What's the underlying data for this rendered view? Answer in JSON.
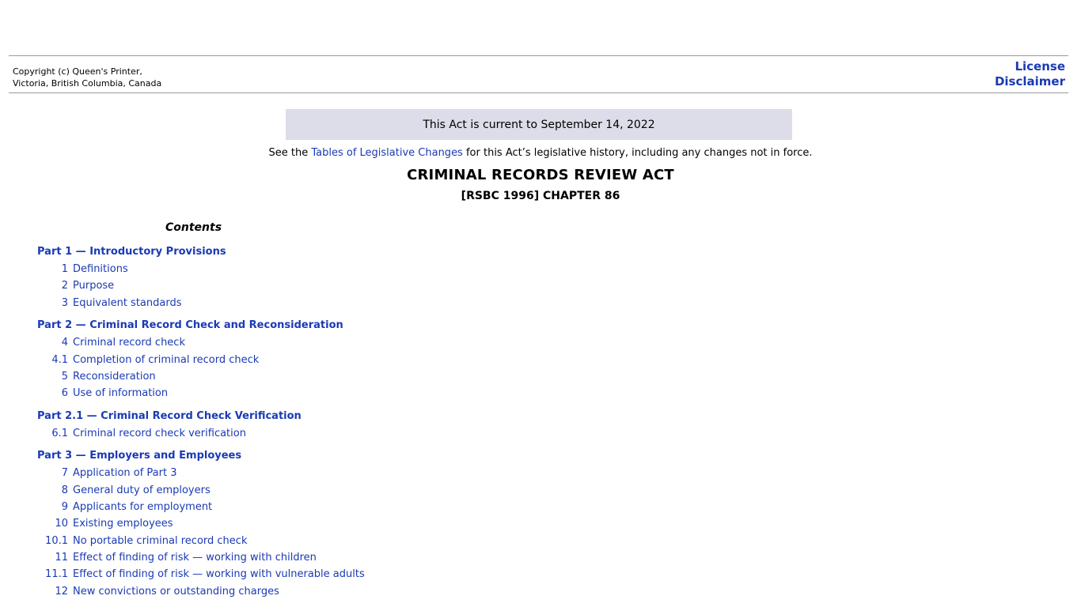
{
  "header": {
    "copyright_line1": "Copyright (c) Queen's Printer,",
    "copyright_line2": "Victoria, British Columbia, Canada",
    "license_label": "License",
    "disclaimer_label": "Disclaimer"
  },
  "currency": {
    "text": "This Act is current to September 14, 2022"
  },
  "history": {
    "prefix": "See the ",
    "link_label": "Tables of Legislative Changes",
    "suffix": " for this Act’s legislative history, including any changes not in force."
  },
  "act": {
    "title": "CRIMINAL RECORDS REVIEW ACT",
    "chapter": "[RSBC 1996] CHAPTER 86"
  },
  "contents": {
    "heading": "Contents",
    "parts": [
      {
        "title": "Part 1 — Introductory Provisions",
        "sections": [
          {
            "num": "1",
            "label": "Definitions"
          },
          {
            "num": "2",
            "label": "Purpose"
          },
          {
            "num": "3",
            "label": "Equivalent standards"
          }
        ]
      },
      {
        "title": "Part 2 — Criminal Record Check and Reconsideration",
        "sections": [
          {
            "num": "4",
            "label": "Criminal record check"
          },
          {
            "num": "4.1",
            "label": "Completion of criminal record check"
          },
          {
            "num": "5",
            "label": "Reconsideration"
          },
          {
            "num": "6",
            "label": "Use of information"
          }
        ]
      },
      {
        "title": "Part 2.1 — Criminal Record Check Verification",
        "sections": [
          {
            "num": "6.1",
            "label": "Criminal record check verification"
          }
        ]
      },
      {
        "title": "Part 3 — Employers and Employees",
        "sections": [
          {
            "num": "7",
            "label": "Application of Part 3"
          },
          {
            "num": "8",
            "label": "General duty of employers"
          },
          {
            "num": "9",
            "label": "Applicants for employment"
          },
          {
            "num": "10",
            "label": "Existing employees"
          },
          {
            "num": "10.1",
            "label": "No portable criminal record check"
          },
          {
            "num": "11",
            "label": "Effect of finding of risk — working with children"
          },
          {
            "num": "11.1",
            "label": "Effect of finding of risk — working with vulnerable adults"
          },
          {
            "num": "12",
            "label": "New convictions or outstanding charges"
          }
        ]
      }
    ]
  },
  "colors": {
    "link": "#1a3ab5",
    "currency_box_bg": "#dddde9",
    "rule": "#999999"
  }
}
